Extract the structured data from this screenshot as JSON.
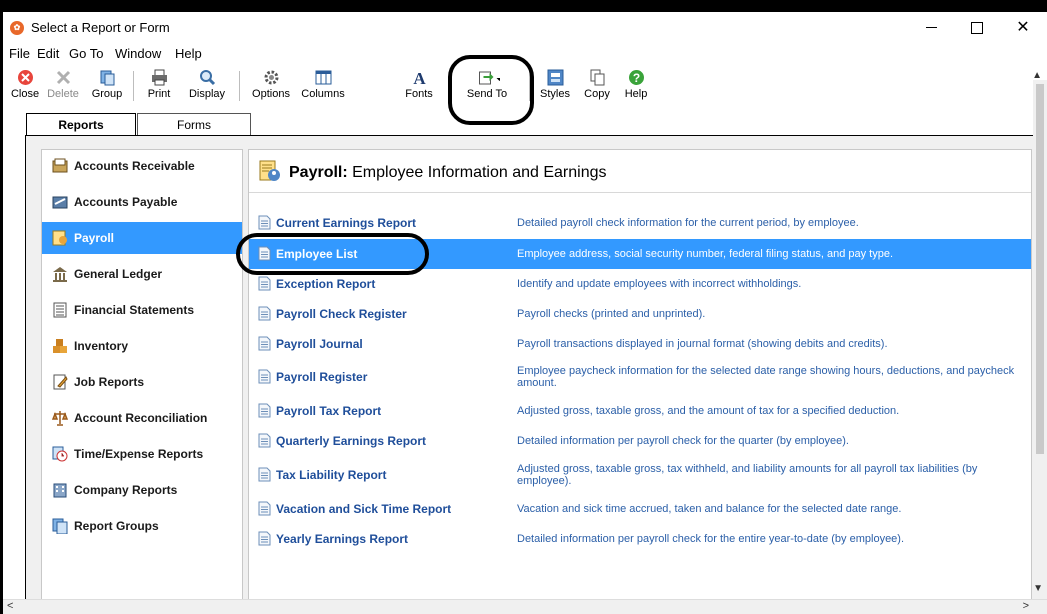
{
  "window": {
    "title": "Select a Report or Form"
  },
  "menu": [
    "File",
    "Edit",
    "Go To",
    "Window",
    "Help"
  ],
  "toolbar": {
    "close": "Close",
    "delete": "Delete",
    "group": "Group",
    "print": "Print",
    "display": "Display",
    "options": "Options",
    "columns": "Columns",
    "fonts": "Fonts",
    "send_to": "Send To",
    "styles": "Styles",
    "copy": "Copy",
    "help": "Help"
  },
  "tabs": {
    "reports": "Reports",
    "forms": "Forms"
  },
  "categories": [
    "Accounts Receivable",
    "Accounts Payable",
    "Payroll",
    "General Ledger",
    "Financial Statements",
    "Inventory",
    "Job Reports",
    "Account Reconciliation",
    "Time/Expense Reports",
    "Company Reports",
    "Report Groups"
  ],
  "selected_category": "Payroll",
  "section": {
    "title_bold": "Payroll:",
    "title_rest": " Employee Information and Earnings"
  },
  "reports": [
    {
      "name": "Current Earnings Report",
      "desc": "Detailed payroll check information for the current period, by employee."
    },
    {
      "name": "Employee List",
      "desc": "Employee address, social security number, federal filing status, and pay type."
    },
    {
      "name": "Exception Report",
      "desc": "Identify and update employees with incorrect withholdings."
    },
    {
      "name": "Payroll Check Register",
      "desc": "Payroll checks (printed and unprinted)."
    },
    {
      "name": "Payroll Journal",
      "desc": "Payroll transactions displayed in journal format (showing debits and credits)."
    },
    {
      "name": "Payroll Register",
      "desc": "Employee paycheck information for the selected date range showing hours, deductions, and paycheck amount."
    },
    {
      "name": "Payroll Tax Report",
      "desc": "Adjusted gross, taxable gross, and the amount of tax for a specified deduction."
    },
    {
      "name": "Quarterly Earnings Report",
      "desc": "Detailed information per payroll check for the quarter (by employee)."
    },
    {
      "name": "Tax Liability Report",
      "desc": "Adjusted gross, taxable gross, tax withheld, and liability amounts for all payroll tax liabilities (by employee)."
    },
    {
      "name": "Vacation and Sick Time Report",
      "desc": "Vacation and sick time accrued, taken and balance for the selected date range."
    },
    {
      "name": "Yearly Earnings Report",
      "desc": "Detailed information per payroll check for the entire year-to-date (by employee)."
    }
  ],
  "selected_report": "Employee List",
  "colors": {
    "accent": "#3399ff",
    "link": "#1f4e9a",
    "desc": "#2b5fa8"
  }
}
